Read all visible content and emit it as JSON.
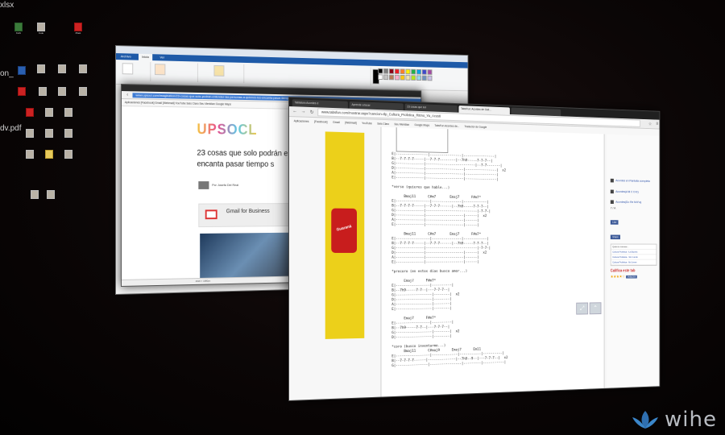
{
  "desktop": {
    "edge_labels": [
      "xlsx",
      "on_",
      "dv.pdf"
    ],
    "icons": [
      {
        "label": "Kohi",
        "type": "x"
      },
      {
        "label": "Cole",
        "type": "j"
      },
      {
        "label": "Plast",
        "type": "p"
      },
      {
        "label": "",
        "type": "b"
      },
      {
        "label": "",
        "type": "j"
      },
      {
        "label": "",
        "type": "j"
      },
      {
        "label": "",
        "type": "j"
      },
      {
        "label": "",
        "type": "p"
      },
      {
        "label": "",
        "type": "j"
      },
      {
        "label": "",
        "type": "j"
      },
      {
        "label": "",
        "type": "j"
      },
      {
        "label": "",
        "type": "p"
      },
      {
        "label": "",
        "type": "j"
      },
      {
        "label": "",
        "type": "j"
      },
      {
        "label": "",
        "type": "j"
      },
      {
        "label": "",
        "type": "j"
      },
      {
        "label": "",
        "type": "j"
      },
      {
        "label": "",
        "type": "j"
      },
      {
        "label": "",
        "type": "f"
      },
      {
        "label": "",
        "type": "j"
      },
      {
        "label": "",
        "type": "j"
      },
      {
        "label": "",
        "type": "j"
      }
    ]
  },
  "paint": {
    "tabs": [
      "Archivo",
      "Inicio",
      "Ver"
    ],
    "colors": [
      "#000000",
      "#7f7f7f",
      "#880015",
      "#ed1c24",
      "#ff7f27",
      "#fff200",
      "#22b14c",
      "#00a2e8",
      "#3f48cc",
      "#a349a4",
      "#ffffff",
      "#c3c3c3",
      "#b97a57",
      "#ffaec9",
      "#ffc90e",
      "#efe4b0",
      "#b5e61d",
      "#99d9ea",
      "#7092be",
      "#c8bfe7"
    ]
  },
  "browser_back": {
    "url": "www.upsocl.com/imagination/23-cosas-que-solo-podran-entender-las-personas-a-quienes-les-encanta-pasar-tiempo-solas",
    "bookmarks": "Aplicaciones  [Facebook]  Gmail  [Webmail]  YouTube  Seis Claro  Seu Meridian  Google Maps",
    "logo": "UPSOCL",
    "headline": "23 cosas que solo podrán e les encanta pasar tiempo s",
    "author": "Por Josefa Del Real",
    "ad_title": "Gmail for Business",
    "status": "1920 × 1080px"
  },
  "browser_front": {
    "tabs": [
      {
        "label": "Tablatura Acordes d"
      },
      {
        "label": "Aprende a tocar"
      },
      {
        "label": "23 cosas que sol"
      },
      {
        "label": "TabsFun: Acordes de Guit…",
        "active": true
      },
      {
        "label": ""
      }
    ],
    "url": "www.tabsfun.com/mostrar.aspx?cancion=tlp_Cultura_Profetica_Ritmo_Ya_Acusti",
    "bookmarks": [
      "Aplicaciones",
      "[Facebook]",
      "Gmail",
      "[Webmail]",
      "YouTube",
      "Seis Claro",
      "Seu Meridian",
      "Google Maps",
      "TabsFun Acordes de...",
      "Traductor de Google"
    ],
    "ad_brand": "Guaraná",
    "sidebar": {
      "link1": "Acordes en Pantalla completa",
      "link2": "Acordes(A B C D E)",
      "link3": "Acordes(Do Re Mi Fa)",
      "count": "7 / A",
      "like": "Like",
      "share": "Share",
      "songs_header": "Quizá te interese...",
      "songs": [
        "Cultura Profética - La Espera",
        "Cultura Profética - Sin ti ando",
        "Cultura Profética - Ilo Llovez"
      ],
      "rate": "Califica este tab",
      "stars": "★★★★☆",
      "vote": "Votación"
    },
    "tab_text": "E|----------------|----------------|----------------|\nB|--7-7-7-7-----|--7-7-7--------|--7h9-----7-7-7--|\nG|--------------|-------------------------|--7-7-------|\nD|--------------|-------------------|----------------|  x2\nA|--------------|-------------------|----------------|\nE|--------------|-------------------|----------------|\n\n*verso (quieres que hable...)\n\n      Bmaj11      C#m7       Emaj7      F#m7*\nE|-----------------|---------------|------------|\nB|--7-7-7-7-----|--7-7-7------|--7h9-----7-7-7--|\nG|--------------|--------------------------|-7-7-|\nD|--------------|-------------------|------|  x2\nA|--------------|-------------------|------|\nE|--------------|-------------------|------|\n\n      Bmaj11      C#m7       Emaj7      F#m7*\nE|-----------------|---------------|------------|\nB|--7-7-7-7-----|--7-7-7------|--7h9-----7-7-7--|\nG|--------------|--------------------------|-7-7-|\nD|--------------|-------------------|------|  x2\nA|--------------|-------------------|------|\nE|--------------|-------------------|------|\n\n*precoro (en estos dias busco amor...)\n\n      Emaj7      F#m7*\nE|-----------------|----------|\nB|--7h9-----7-7--|---7-7-7--|\nG|------------------|--------|  x2\nD|------------------|--------|\nA|------------------|--------|\nE|------------------|--------|\n\n      Emaj7      F#m7*\nE|-----------------|----------|\nB|--7h9-----7-7--|---7-7-7--|\nG|------------------|--------|  x2\nD|------------------|--------|\n\n*coro (busco inventarme...)\n      Bmaj11      C#maj9      Emaj7      Em11\nE|-----------------|-------------|-----------|----------|\nB|--7-7-7-7------|--------------|--7h9--9--|---7-7-7--|  x2\nG|----------------|----------------|---------|-----------|"
  }
}
